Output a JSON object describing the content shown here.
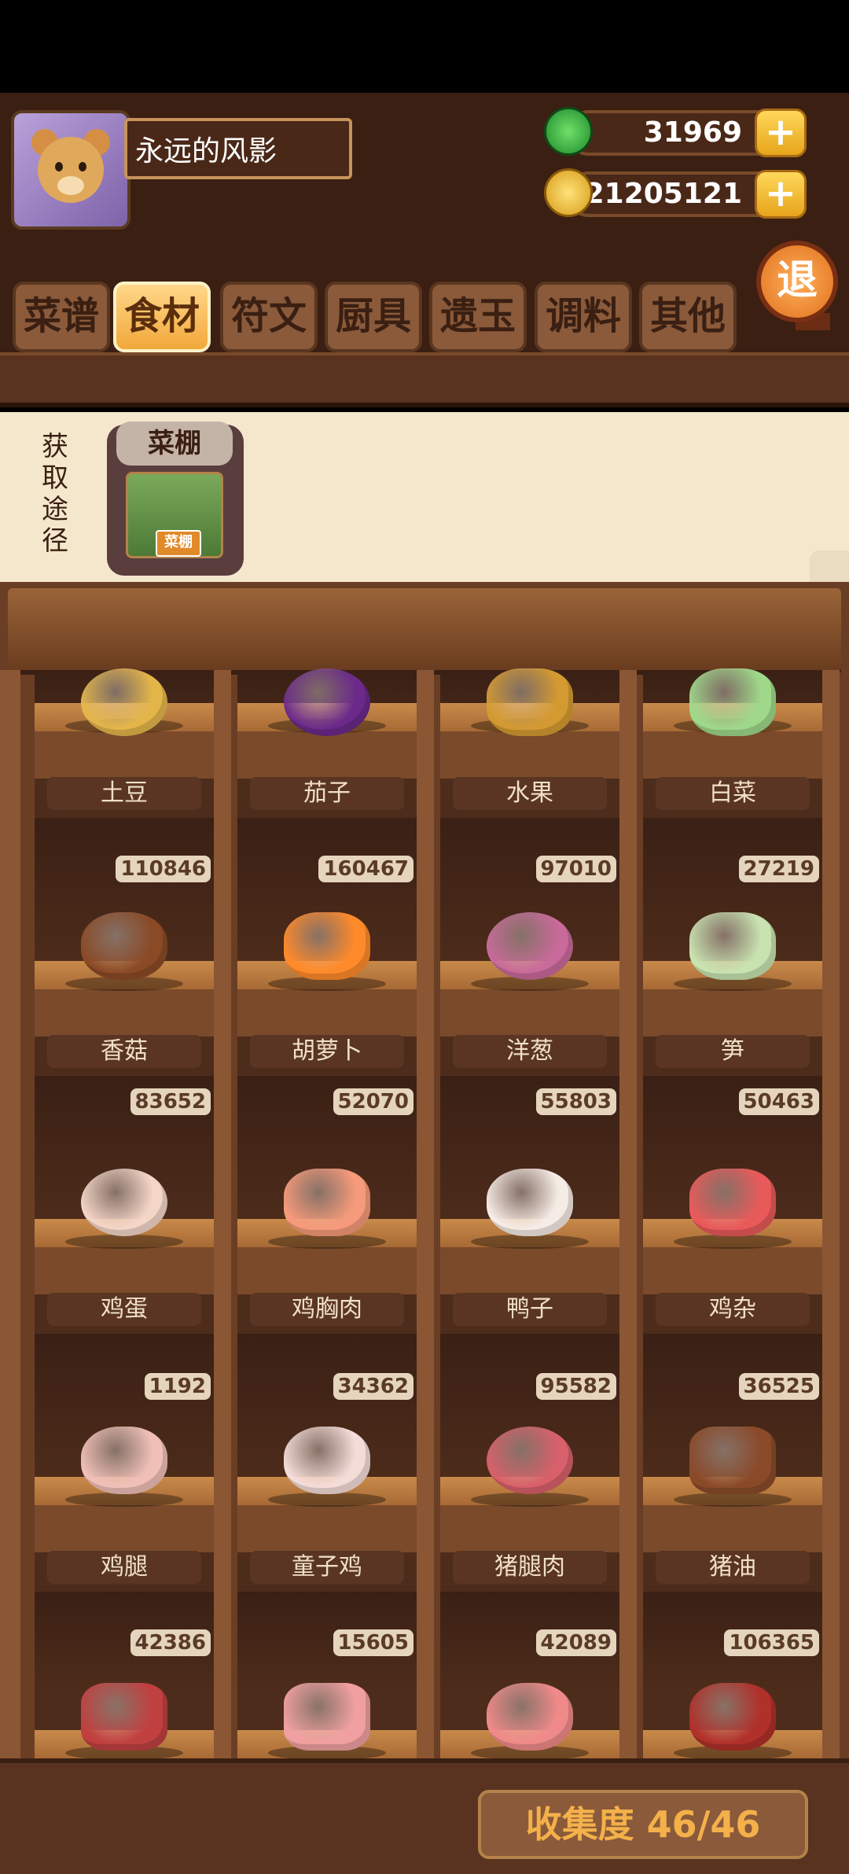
{
  "player": {
    "name": "永远的风影"
  },
  "currencies": {
    "jade": "31969",
    "coins": "21205121",
    "plus": "+"
  },
  "exit_label": "退",
  "tabs": [
    "菜谱",
    "食材",
    "符文",
    "厨具",
    "遗玉",
    "调料",
    "其他"
  ],
  "active_tab": "食材",
  "source": {
    "label": "获取途径",
    "place": "菜棚",
    "tag": "菜棚"
  },
  "items": [
    {
      "name": "土豆",
      "count": ""
    },
    {
      "name": "茄子",
      "count": ""
    },
    {
      "name": "水果",
      "count": ""
    },
    {
      "name": "白菜",
      "count": ""
    },
    {
      "name": "香菇",
      "count": "110846"
    },
    {
      "name": "胡萝卜",
      "count": "160467"
    },
    {
      "name": "洋葱",
      "count": "97010"
    },
    {
      "name": "笋",
      "count": "27219"
    },
    {
      "name": "鸡蛋",
      "count": "83652"
    },
    {
      "name": "鸡胸肉",
      "count": "52070"
    },
    {
      "name": "鸭子",
      "count": "55803"
    },
    {
      "name": "鸡杂",
      "count": "50463"
    },
    {
      "name": "鸡腿",
      "count": "1192"
    },
    {
      "name": "童子鸡",
      "count": "34362"
    },
    {
      "name": "猪腿肉",
      "count": "95582"
    },
    {
      "name": "猪油",
      "count": "36525"
    },
    {
      "name": "",
      "count": "42386"
    },
    {
      "name": "",
      "count": "15605"
    },
    {
      "name": "",
      "count": "42089"
    },
    {
      "name": "",
      "count": "106365"
    }
  ],
  "collection": "收集度 46/46",
  "colors": {
    "wood_dark": "#3a1f12",
    "wood_mid": "#6a3e25",
    "accent_orange": "#f2a83a",
    "paper": "#f4e7cb"
  }
}
